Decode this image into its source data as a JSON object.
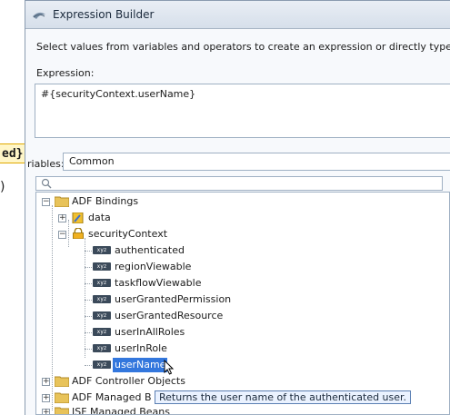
{
  "background": {
    "callout_text": "ed}",
    "paren_text": ")"
  },
  "dialog": {
    "title": "Expression Builder",
    "instructions": "Select values from variables and operators to create an expression or directly type the e",
    "expression_label": "Expression:",
    "expression_value": "#{securityContext.userName}",
    "variables_label": "riables:",
    "variables_selected": "Common",
    "search_placeholder": ""
  },
  "tree": {
    "adf_bindings": "ADF Bindings",
    "data": "data",
    "security_context": "securityContext",
    "items": [
      "authenticated",
      "regionViewable",
      "taskflowViewable",
      "userGrantedPermission",
      "userGrantedResource",
      "userInAllRoles",
      "userInRole",
      "userName"
    ],
    "adf_controller_objects": "ADF Controller Objects",
    "adf_managed_beans": "ADF Managed B",
    "jsf_managed_beans": "JSF Managed Beans",
    "var_icon_text": "xyz"
  },
  "tooltip": "Returns the user name of the authenticated user.",
  "colors": {
    "selection": "#3377dd",
    "tooltip_bg": "#eaf2ff",
    "callout_bg": "#fff6c8"
  }
}
